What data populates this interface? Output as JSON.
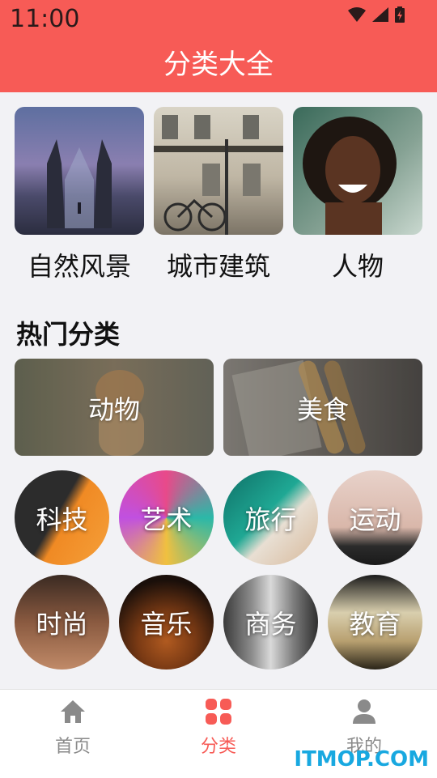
{
  "status": {
    "time": "11:00"
  },
  "header": {
    "title": "分类大全"
  },
  "top_categories": [
    {
      "label": "自然风景"
    },
    {
      "label": "城市建筑"
    },
    {
      "label": "人物"
    }
  ],
  "section": {
    "title": "热门分类"
  },
  "hot": [
    {
      "label": "动物"
    },
    {
      "label": "美食"
    }
  ],
  "circles": [
    {
      "label": "科技"
    },
    {
      "label": "艺术"
    },
    {
      "label": "旅行"
    },
    {
      "label": "运动"
    },
    {
      "label": "时尚"
    },
    {
      "label": "音乐"
    },
    {
      "label": "商务"
    },
    {
      "label": "教育"
    }
  ],
  "nav": {
    "home": "首页",
    "category": "分类",
    "mine": "我的",
    "active_color": "#f75b56",
    "inactive_color": "#8a8a8a"
  },
  "watermark": "ITMOP.COM"
}
